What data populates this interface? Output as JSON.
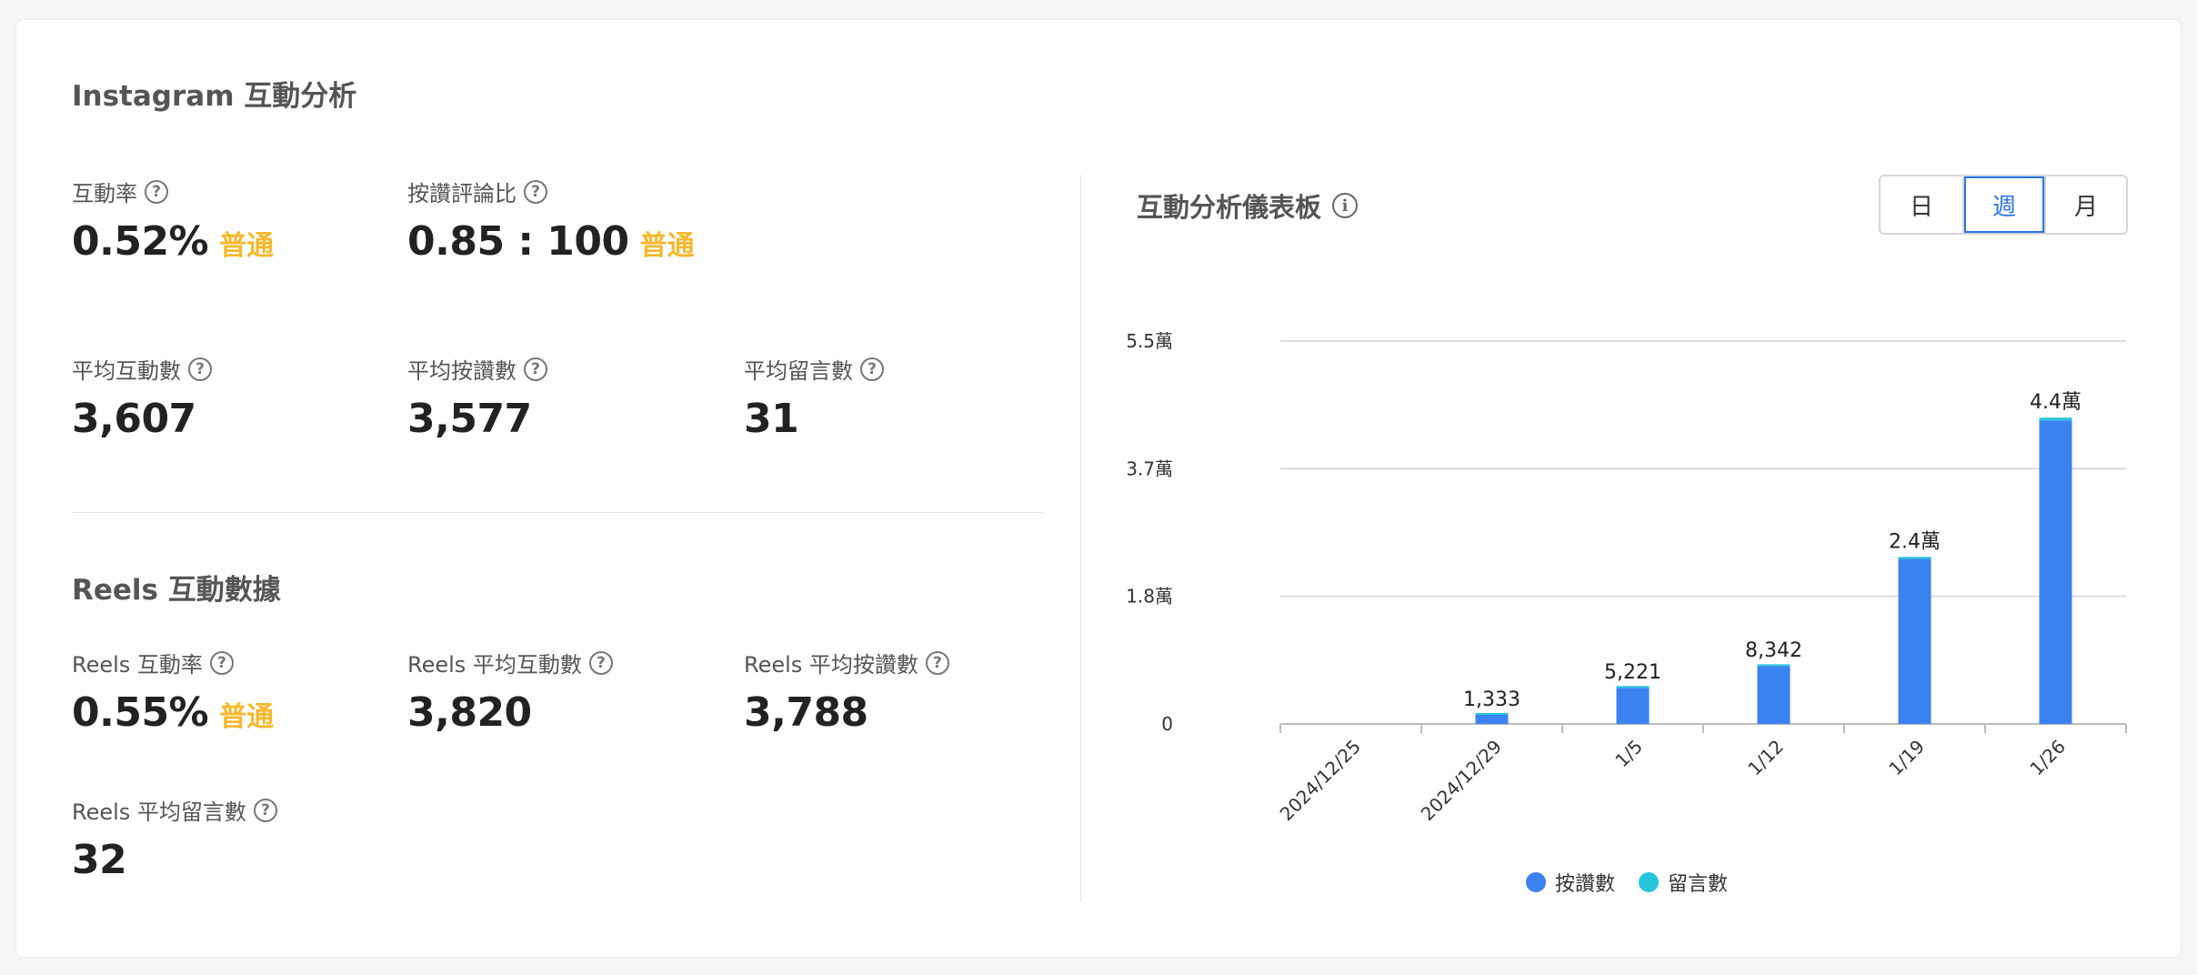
{
  "title": "Instagram 互動分析",
  "overview": {
    "engagement_rate": {
      "label": "互動率",
      "value": "0.52%",
      "badge": "普通"
    },
    "like_comment_ratio": {
      "label": "按讚評論比",
      "value": "0.85 : 100",
      "badge": "普通"
    },
    "avg_engagement": {
      "label": "平均互動數",
      "value": "3,607"
    },
    "avg_likes": {
      "label": "平均按讚數",
      "value": "3,577"
    },
    "avg_comments": {
      "label": "平均留言數",
      "value": "31"
    }
  },
  "reels": {
    "title": "Reels 互動數據",
    "engagement_rate": {
      "label": "Reels 互動率",
      "value": "0.55%",
      "badge": "普通"
    },
    "avg_engagement": {
      "label": "Reels 平均互動數",
      "value": "3,820"
    },
    "avg_likes": {
      "label": "Reels 平均按讚數",
      "value": "3,788"
    },
    "avg_comments": {
      "label": "Reels 平均留言數",
      "value": "32"
    }
  },
  "dashboard": {
    "title": "互動分析儀表板",
    "periods": [
      "日",
      "週",
      "月"
    ],
    "active_period": "週"
  },
  "colors": {
    "likes": "#3b82f0",
    "comments": "#26c6da",
    "badge": "#f5b82e",
    "accent": "#2b73e6"
  },
  "chart_data": {
    "type": "bar",
    "stacked": true,
    "categories": [
      "2024/12/25",
      "2024/12/29",
      "1/5",
      "1/12",
      "1/19",
      "1/26"
    ],
    "series": [
      {
        "name": "按讚數",
        "values": [
          0,
          1310,
          5190,
          8310,
          23700,
          43600
        ]
      },
      {
        "name": "留言數",
        "values": [
          0,
          23,
          31,
          32,
          300,
          400
        ]
      }
    ],
    "data_labels": [
      "",
      "1,333",
      "5,221",
      "8,342",
      "2.4萬",
      "4.4萬"
    ],
    "y_ticks": [
      {
        "value": 0,
        "label": "0"
      },
      {
        "value": 18333,
        "label": "1.8萬"
      },
      {
        "value": 36667,
        "label": "3.7萬"
      },
      {
        "value": 55000,
        "label": "5.5萬"
      }
    ],
    "ylim": [
      0,
      55000
    ],
    "grid": true,
    "legend": "bottom"
  }
}
